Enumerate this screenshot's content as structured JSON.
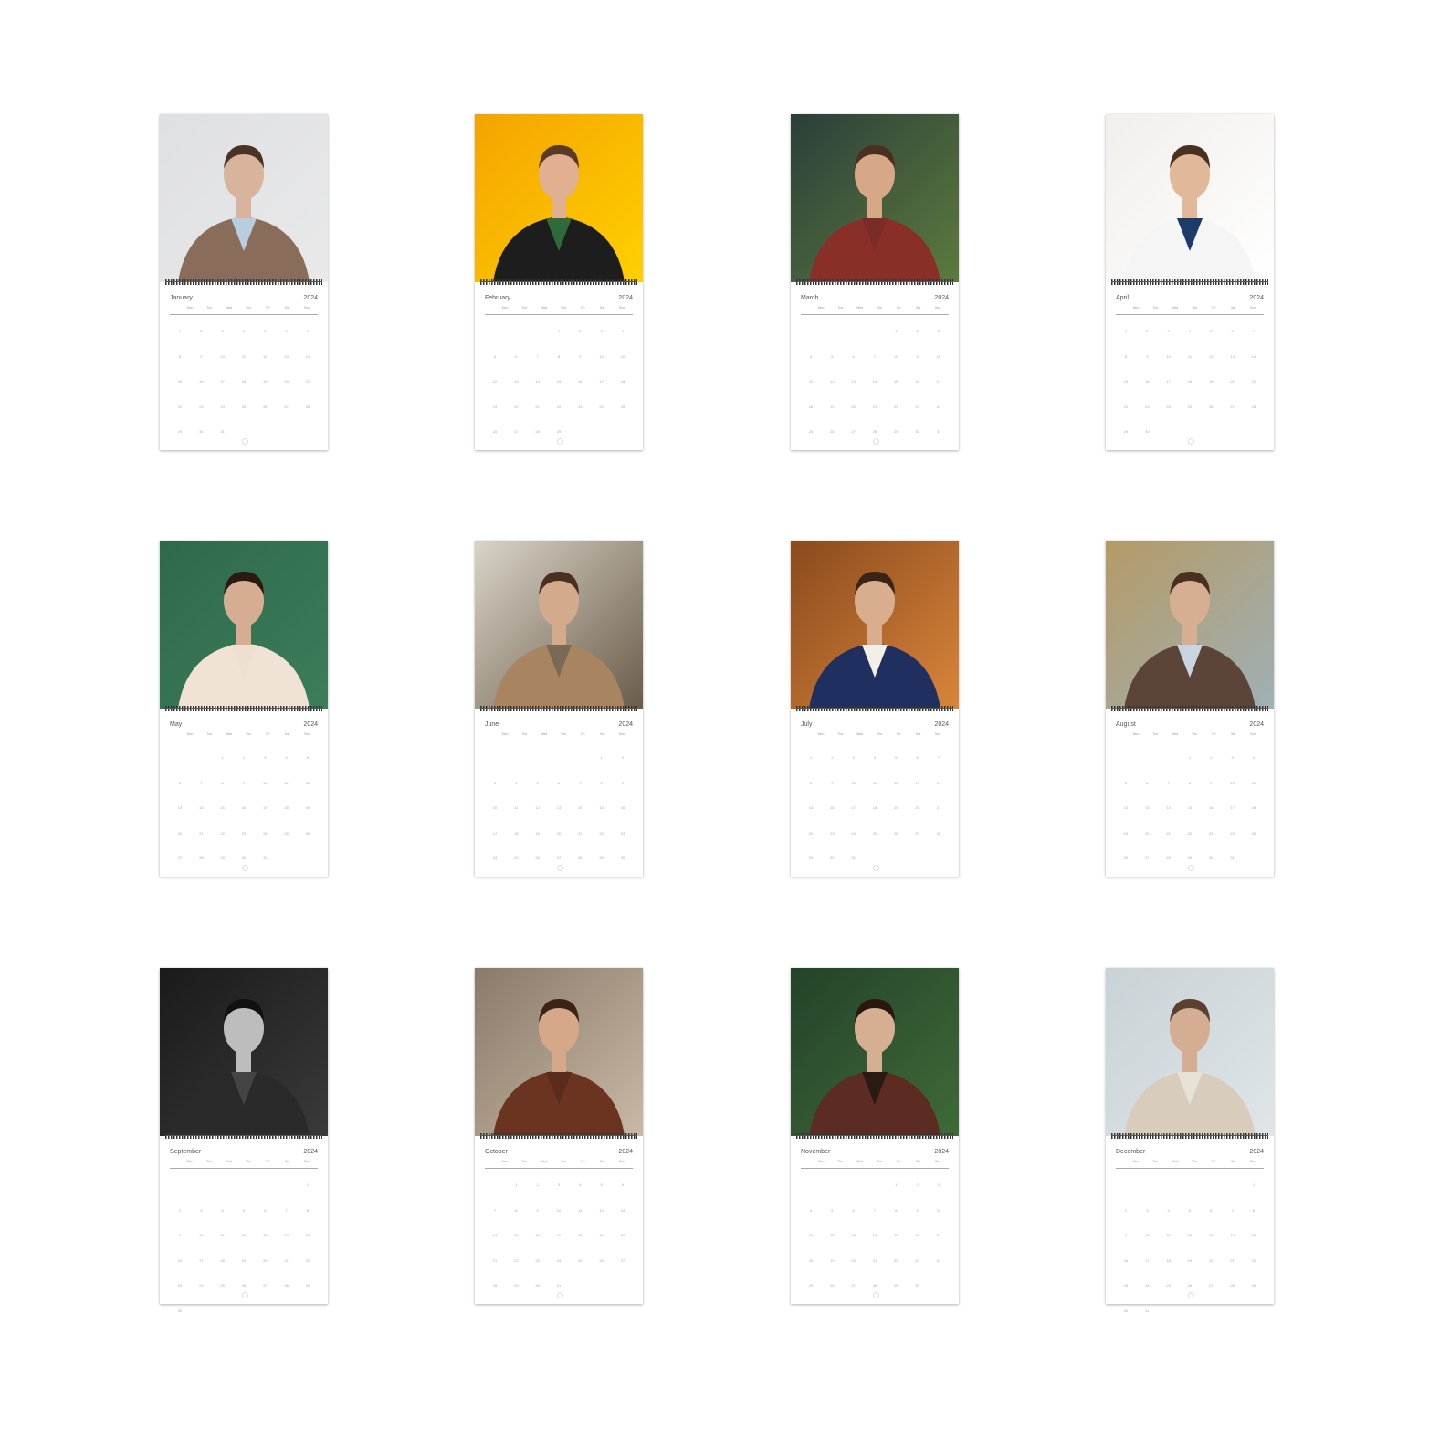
{
  "calendar": {
    "year": "2024",
    "weekdays": [
      "Mon",
      "Tue",
      "Wed",
      "Thu",
      "Fri",
      "Sat",
      "Sun"
    ],
    "months": [
      {
        "name": "January",
        "photo": {
          "bg": "#dfe0e2",
          "bg2": "#e9e9ea",
          "jacket": "#8a6c5a",
          "shirt": "#b9cde0",
          "skin": "#d8b49c",
          "hair": "#4a3326"
        }
      },
      {
        "name": "February",
        "photo": {
          "bg": "#f4a300",
          "bg2": "#ffd000",
          "jacket": "#1d1d1d",
          "shirt": "#2f6b3a",
          "skin": "#e0b090",
          "hair": "#5a3a24"
        }
      },
      {
        "name": "March",
        "photo": {
          "bg": "#2b3f3a",
          "bg2": "#5d7a3e",
          "jacket": "#8a2f28",
          "shirt": "#7a2c26",
          "skin": "#d6a888",
          "hair": "#4a3020"
        }
      },
      {
        "name": "April",
        "photo": {
          "bg": "#f1efec",
          "bg2": "#ffffff",
          "jacket": "#f5f5f5",
          "shirt": "#1e3a6a",
          "skin": "#e2b89a",
          "hair": "#4a3020"
        }
      },
      {
        "name": "May",
        "photo": {
          "bg": "#2e6a4a",
          "bg2": "#3c7d5a",
          "jacket": "#f0e2d4",
          "shirt": "#eedfd0",
          "skin": "#d6ad92",
          "hair": "#2a1a12"
        }
      },
      {
        "name": "June",
        "photo": {
          "bg": "#d9d4c8",
          "bg2": "#6b5c4a",
          "jacket": "#a88560",
          "shirt": "#7a6a55",
          "skin": "#d4aa8c",
          "hair": "#4a3020"
        }
      },
      {
        "name": "July",
        "photo": {
          "bg": "#8a4a1e",
          "bg2": "#d9853a",
          "jacket": "#1f3060",
          "shirt": "#f2efe6",
          "skin": "#d9ae8e",
          "hair": "#3a2416"
        }
      },
      {
        "name": "August",
        "photo": {
          "bg": "#b59a66",
          "bg2": "#9fb0b5",
          "jacket": "#5c4438",
          "shirt": "#c8d4e0",
          "skin": "#d6ae92",
          "hair": "#4a3020"
        }
      },
      {
        "name": "September",
        "photo": {
          "bg": "#1a1a1a",
          "bg2": "#3a3a3a",
          "jacket": "#2a2a2a",
          "shirt": "#444444",
          "skin": "#bdbdbd",
          "hair": "#111111"
        }
      },
      {
        "name": "October",
        "photo": {
          "bg": "#8a7a6a",
          "bg2": "#c8b8a4",
          "jacket": "#6a3420",
          "shirt": "#5a2c1c",
          "skin": "#d4a888",
          "hair": "#3a2416"
        }
      },
      {
        "name": "November",
        "photo": {
          "bg": "#24432a",
          "bg2": "#3f6a38",
          "jacket": "#5c2c22",
          "shirt": "#2a1a14",
          "skin": "#d6ae92",
          "hair": "#2a1810"
        }
      },
      {
        "name": "December",
        "photo": {
          "bg": "#c9d2d6",
          "bg2": "#dfe5e8",
          "jacket": "#d8ccbc",
          "shirt": "#e8e2d6",
          "skin": "#d4ad92",
          "hair": "#5a4030"
        }
      }
    ]
  }
}
